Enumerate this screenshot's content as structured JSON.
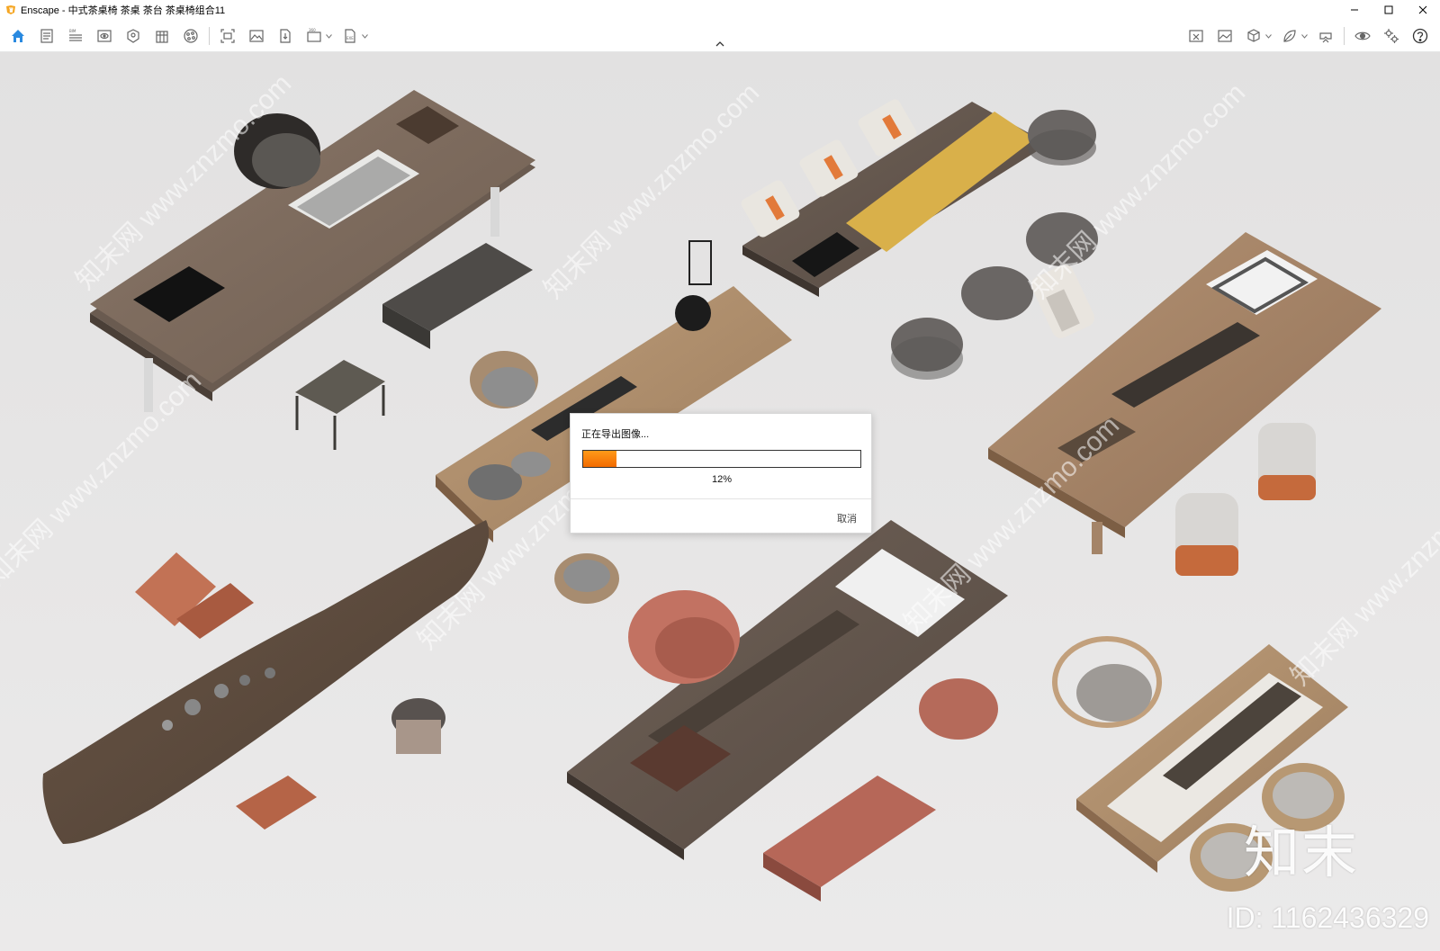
{
  "window": {
    "title": "Enscape - 中式茶桌椅 茶桌 茶台 茶桌椅组合11",
    "controls": {
      "minimize": "minimize-icon",
      "maximize": "maximize-icon",
      "close": "close-icon"
    }
  },
  "toolbar": {
    "left_icons": [
      "home-icon",
      "document-list-icon",
      "bim-list-icon",
      "view-icon",
      "asset-library-icon",
      "building-icon",
      "materials-icon",
      "screenshot-icon",
      "image-icon",
      "export-file-icon",
      "panorama-360-icon",
      "exe-export-icon"
    ],
    "right_icons": [
      "map-icon",
      "visual-settings-icon",
      "cube-view-icon",
      "leaf-icon",
      "vr-headset-icon",
      "eye-icon",
      "settings-icon",
      "help-icon"
    ],
    "accent": "#2a8ae0"
  },
  "dialog": {
    "title": "正在导出图像...",
    "progress_percent": "12%",
    "progress_value": 0.12,
    "cancel_label": "取消",
    "progress_color": "#f57c00"
  },
  "watermark": {
    "text": "知末网 www.znzmo.com",
    "brand": "知末",
    "id": "ID: 1162436329"
  }
}
